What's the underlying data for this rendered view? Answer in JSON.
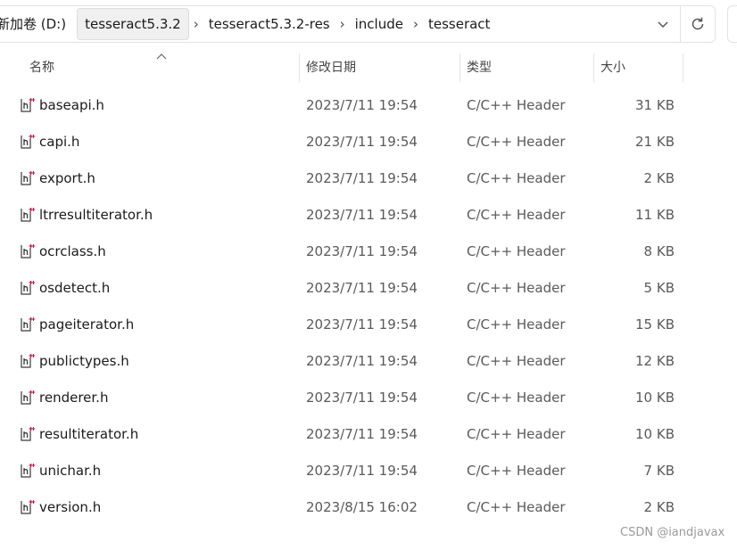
{
  "address_bar": {
    "segments": [
      "新加卷 (D:)",
      "tesseract5.3.2",
      "tesseract5.3.2-res",
      "include",
      "tesseract"
    ],
    "separator": "›"
  },
  "columns": {
    "name": "名称",
    "date": "修改日期",
    "type": "类型",
    "size": "大小"
  },
  "files": [
    {
      "name": "baseapi.h",
      "date": "2023/7/11 19:54",
      "type": "C/C++ Header",
      "size": "31 KB"
    },
    {
      "name": "capi.h",
      "date": "2023/7/11 19:54",
      "type": "C/C++ Header",
      "size": "21 KB"
    },
    {
      "name": "export.h",
      "date": "2023/7/11 19:54",
      "type": "C/C++ Header",
      "size": "2 KB"
    },
    {
      "name": "ltrresultiterator.h",
      "date": "2023/7/11 19:54",
      "type": "C/C++ Header",
      "size": "11 KB"
    },
    {
      "name": "ocrclass.h",
      "date": "2023/7/11 19:54",
      "type": "C/C++ Header",
      "size": "8 KB"
    },
    {
      "name": "osdetect.h",
      "date": "2023/7/11 19:54",
      "type": "C/C++ Header",
      "size": "5 KB"
    },
    {
      "name": "pageiterator.h",
      "date": "2023/7/11 19:54",
      "type": "C/C++ Header",
      "size": "15 KB"
    },
    {
      "name": "publictypes.h",
      "date": "2023/7/11 19:54",
      "type": "C/C++ Header",
      "size": "12 KB"
    },
    {
      "name": "renderer.h",
      "date": "2023/7/11 19:54",
      "type": "C/C++ Header",
      "size": "10 KB"
    },
    {
      "name": "resultiterator.h",
      "date": "2023/7/11 19:54",
      "type": "C/C++ Header",
      "size": "10 KB"
    },
    {
      "name": "unichar.h",
      "date": "2023/7/11 19:54",
      "type": "C/C++ Header",
      "size": "7 KB"
    },
    {
      "name": "version.h",
      "date": "2023/8/15 16:02",
      "type": "C/C++ Header",
      "size": "2 KB"
    }
  ],
  "icons": {
    "file": "header-file-icon",
    "sort": "sort-ascending-icon",
    "dropdown": "chevron-down-icon",
    "refresh": "refresh-icon"
  },
  "watermark": "CSDN @iandjavax",
  "colors": {
    "icon_accent": "#c2185b",
    "icon_ink": "#3a3a3a"
  }
}
